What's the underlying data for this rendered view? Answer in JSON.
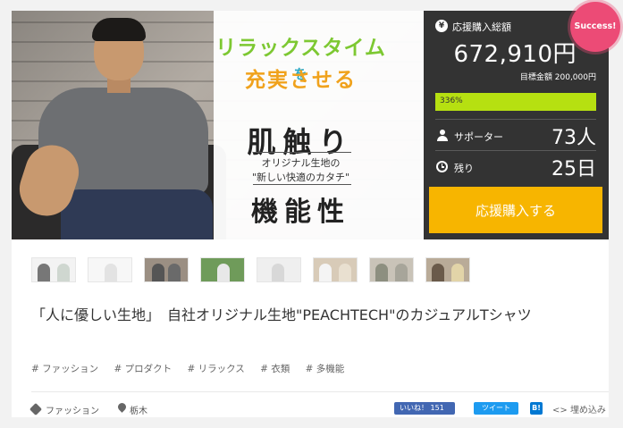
{
  "hero": {
    "catch_line1": "リラックスタイム",
    "catch_line1_suffix": "を",
    "catch_line2": "充実させる",
    "title_line1": "肌触り",
    "sub_line1": "オリジナル生地の",
    "sub_line2": "\"新しい快適のカタチ\"",
    "title_line2": "機能性"
  },
  "stats": {
    "yen_icon": "¥",
    "total_label": "応援購入総額",
    "total_amount": "672,910円",
    "target_label": "目標金額 200,000円",
    "progress_text": "336%",
    "progress_percent": 336,
    "supporters_label": "サポーター",
    "supporters_value": "73人",
    "remaining_label": "残り",
    "remaining_value": "25日",
    "cta_label": "応援購入する",
    "badge": "Success!"
  },
  "colors": {
    "panel_bg": "#333333",
    "progress": "#b6e011",
    "cta": "#f7b500",
    "badge": "#ec4b76"
  },
  "project": {
    "title": "「人に優しい生地」　自社オリジナル生地\"PEACHTECH\"のカジュアルTシャツ",
    "tags": [
      "# ファッション",
      "# プロダクト",
      "# リラックス",
      "# 衣類",
      "# 多機能"
    ]
  },
  "footer": {
    "category": "ファッション",
    "location": "栃木",
    "facebook_label": "いいね！ 151",
    "twitter_label": "ツイート",
    "hatena_label": "B!",
    "embed_label": "埋め込み"
  }
}
